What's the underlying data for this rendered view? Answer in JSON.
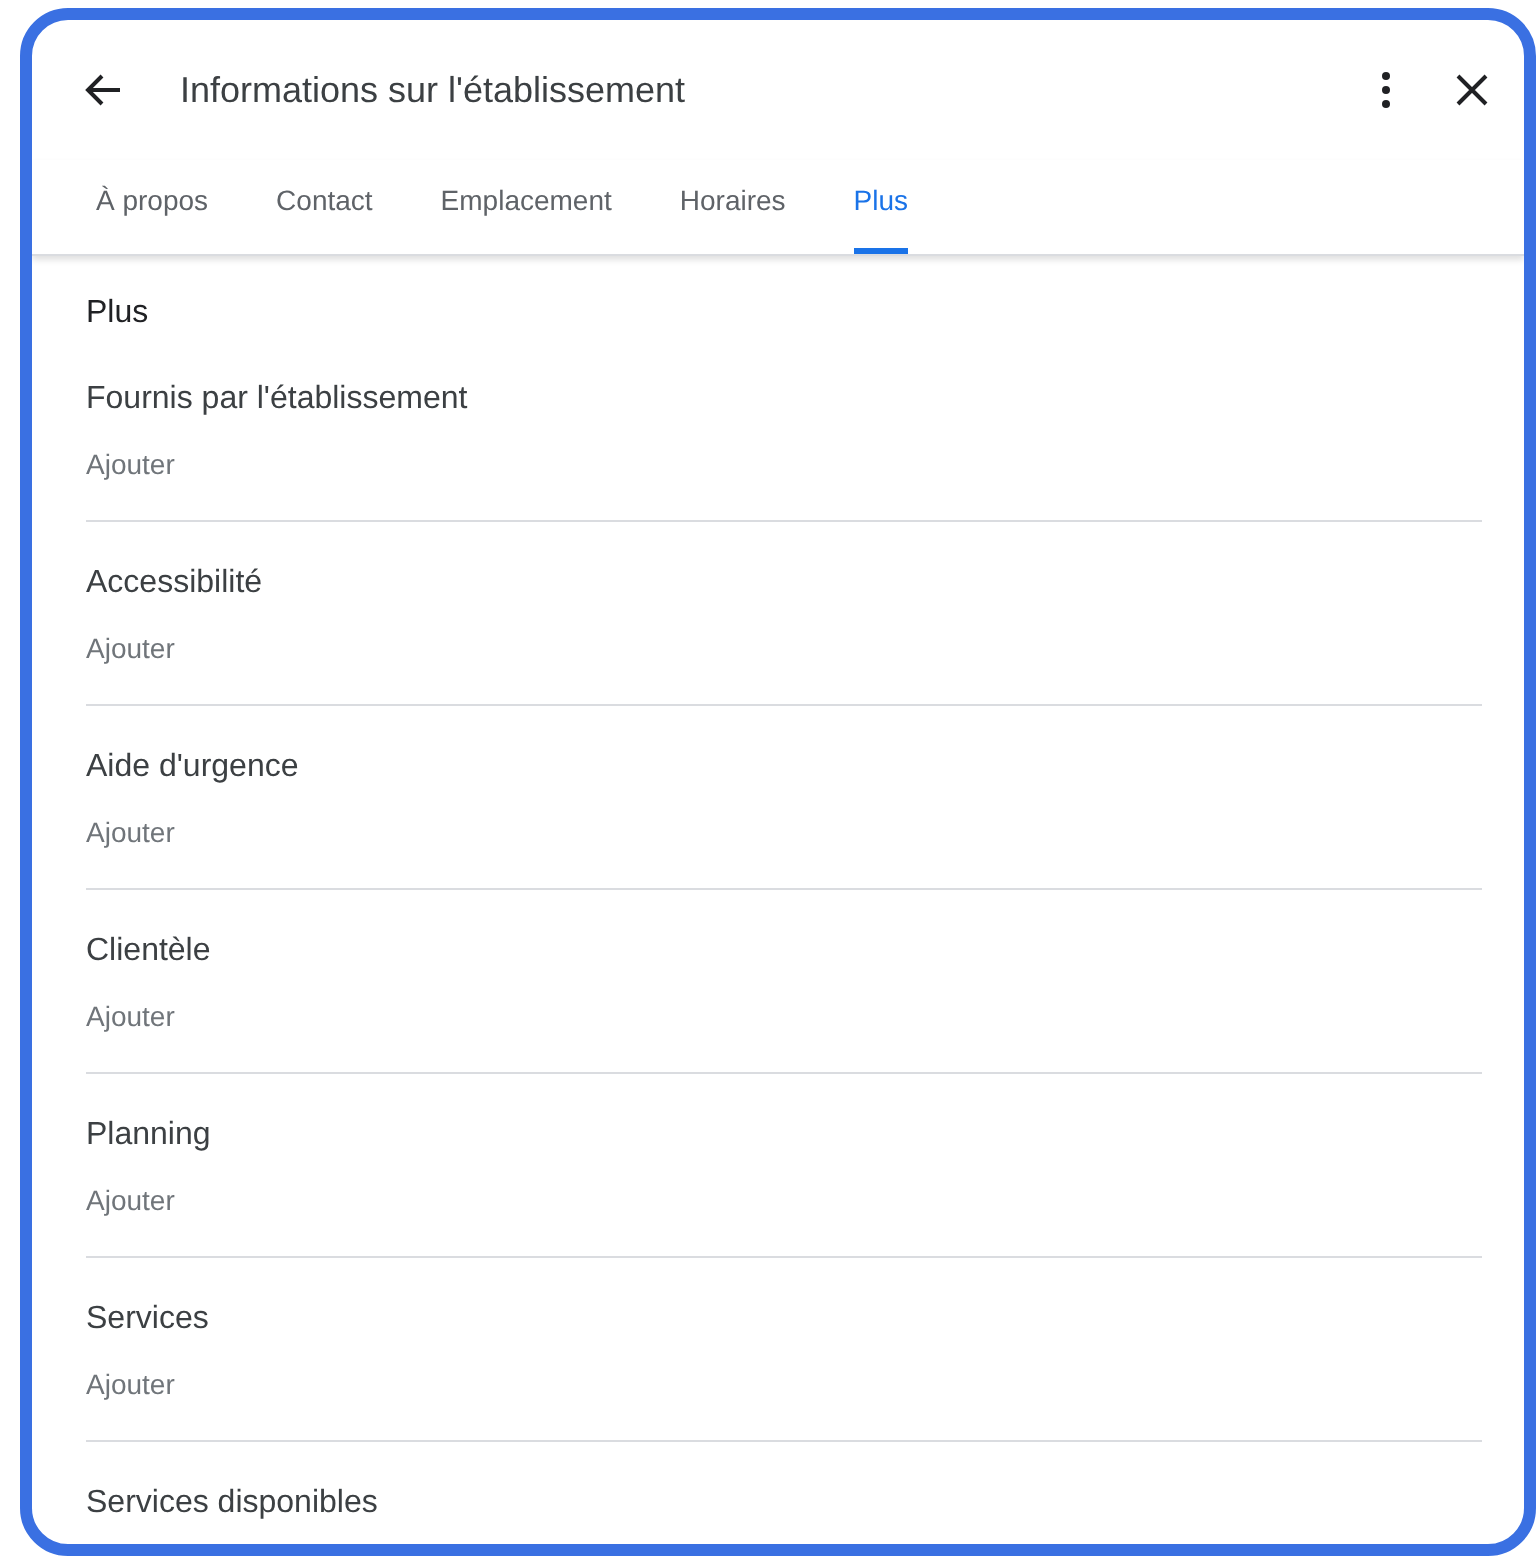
{
  "header": {
    "title": "Informations sur l'établissement"
  },
  "tabs": [
    {
      "label": "À propos",
      "selected": false
    },
    {
      "label": "Contact",
      "selected": false
    },
    {
      "label": "Emplacement",
      "selected": false
    },
    {
      "label": "Horaires",
      "selected": false
    },
    {
      "label": "Plus",
      "selected": true
    }
  ],
  "heading": "Plus",
  "sections": [
    {
      "title": "Fournis par l'établissement",
      "action": "Ajouter"
    },
    {
      "title": "Accessibilité",
      "action": "Ajouter"
    },
    {
      "title": "Aide d'urgence",
      "action": "Ajouter"
    },
    {
      "title": "Clientèle",
      "action": "Ajouter"
    },
    {
      "title": "Planning",
      "action": "Ajouter"
    },
    {
      "title": "Services",
      "action": "Ajouter"
    },
    {
      "title": "Services disponibles"
    }
  ]
}
